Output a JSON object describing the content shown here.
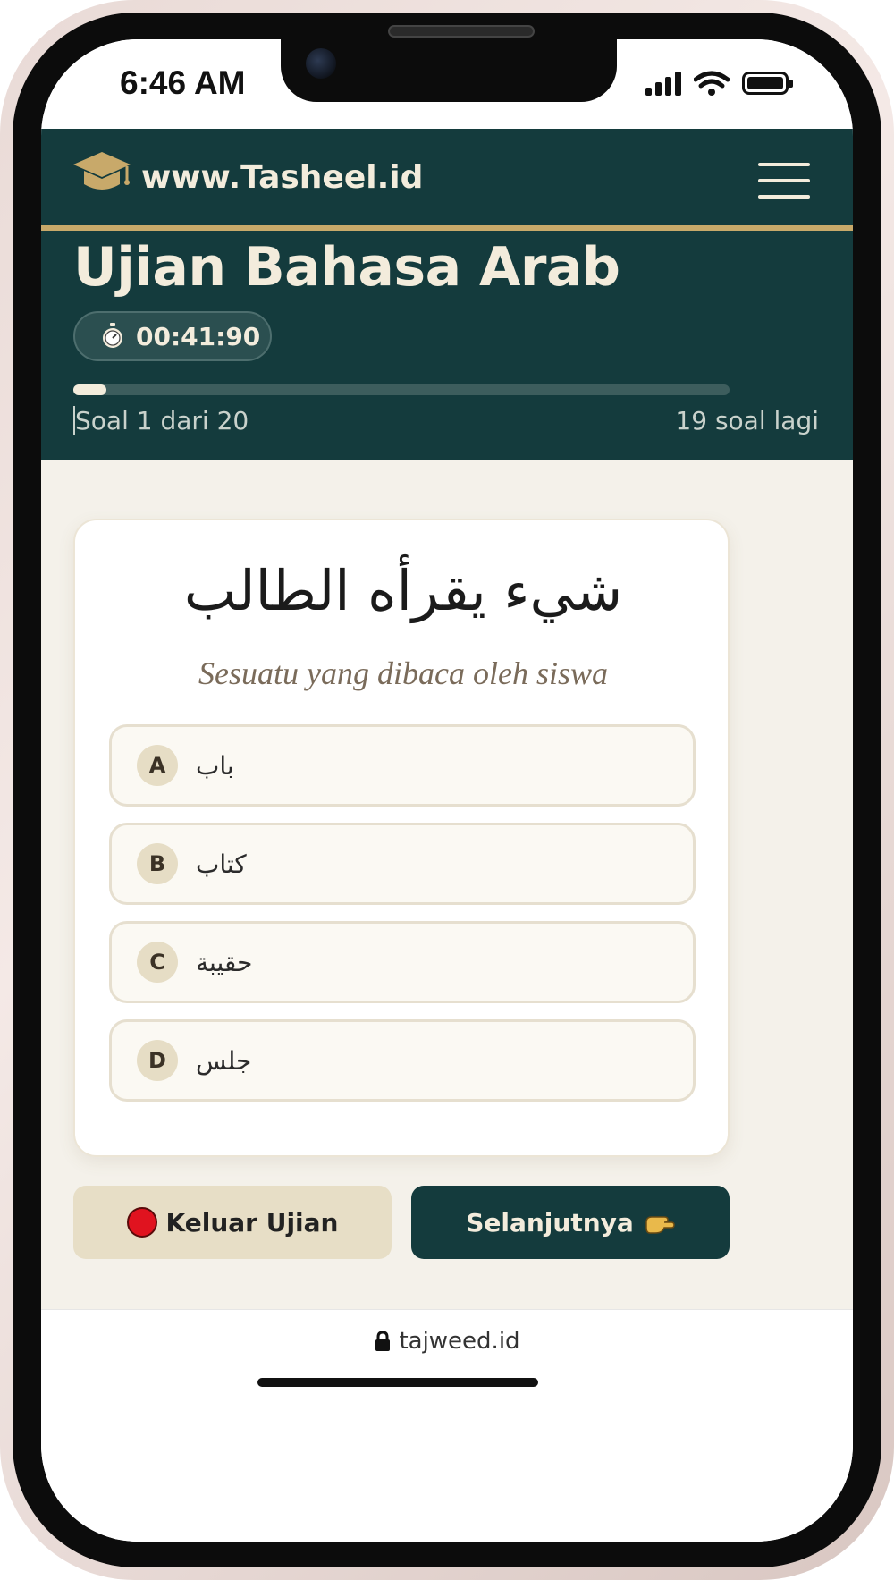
{
  "status_bar": {
    "time": "6:46 AM"
  },
  "header": {
    "site_name": "www.Tasheel.id"
  },
  "exam": {
    "title": "Ujian Bahasa Arab",
    "timer": "00:41:90",
    "progress_fraction": 0.05,
    "progress_left": "Soal 1 dari 20",
    "progress_right": "19 soal lagi"
  },
  "question": {
    "arabic": "شيء يقرأه الطالب",
    "translation": "Sesuatu yang dibaca oleh siswa",
    "options": [
      {
        "letter": "A",
        "text": "باب"
      },
      {
        "letter": "B",
        "text": "كتاب"
      },
      {
        "letter": "C",
        "text": "حقيبة"
      },
      {
        "letter": "D",
        "text": "جلس"
      }
    ]
  },
  "actions": {
    "exit_label": "Keluar Ujian",
    "next_label": "Selanjutnya"
  },
  "browser": {
    "url": "tajweed.id"
  },
  "colors": {
    "primary": "#143b3d",
    "gold": "#c8a96a",
    "cream": "#f4f1ea",
    "record": "#e0131f"
  },
  "icons": [
    "graduation-cap-icon",
    "menu-icon",
    "stopwatch-icon",
    "record-icon",
    "pointing-hand-icon",
    "lock-icon",
    "signal-icon",
    "wifi-icon",
    "battery-icon"
  ]
}
